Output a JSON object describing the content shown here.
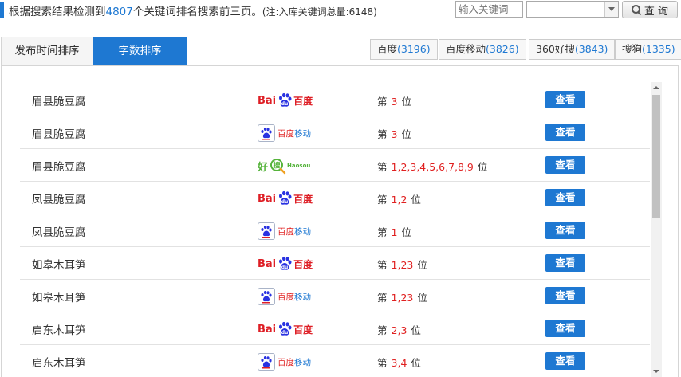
{
  "summary": {
    "prefix": "根据搜索结果检测到",
    "count": "4807",
    "suffix": "个关键词排名搜索前三页。",
    "note": "(注:入库关键词总量:6148)"
  },
  "search": {
    "placeholder": "输入关键词",
    "select_value": "",
    "button_label": "查 询"
  },
  "tabs": [
    {
      "label": "发布时间排序"
    },
    {
      "label": "字数排序"
    }
  ],
  "engines": [
    {
      "name": "百度",
      "count": "(3196)"
    },
    {
      "name": "百度移动",
      "count": "(3826)"
    },
    {
      "name": "360好搜",
      "count": "(3843)"
    },
    {
      "name": "搜狗",
      "count": "(1335)"
    }
  ],
  "rank_prefix": "第",
  "rank_suffix": "位",
  "view_label": "查看",
  "logos": {
    "baidu_latin": "Bai",
    "baidu_cn": "百度",
    "baidu_mobile_cn": "百度",
    "baidu_mobile_m": "移动",
    "haosou_cn": "好",
    "haosou_latin": "Haosou"
  },
  "rows": [
    {
      "keyword": "眉县脆豆腐",
      "engine": "baidu",
      "positions": "3"
    },
    {
      "keyword": "眉县脆豆腐",
      "engine": "baidu-mobile",
      "positions": "3"
    },
    {
      "keyword": "眉县脆豆腐",
      "engine": "haosou",
      "positions": "1,2,3,4,5,6,7,8,9"
    },
    {
      "keyword": "凤县脆豆腐",
      "engine": "baidu",
      "positions": "1,2"
    },
    {
      "keyword": "凤县脆豆腐",
      "engine": "baidu-mobile",
      "positions": "1"
    },
    {
      "keyword": "如皋木耳笋",
      "engine": "baidu",
      "positions": "1,23"
    },
    {
      "keyword": "如皋木耳笋",
      "engine": "baidu-mobile",
      "positions": "1,23"
    },
    {
      "keyword": "启东木耳笋",
      "engine": "baidu",
      "positions": "2,3"
    },
    {
      "keyword": "启东木耳笋",
      "engine": "baidu-mobile",
      "positions": "3,4"
    }
  ],
  "colors": {
    "accent": "#1e78d2",
    "rank": "#e02020",
    "baidu_red": "#de1e25",
    "haosou_green": "#55b33b"
  }
}
